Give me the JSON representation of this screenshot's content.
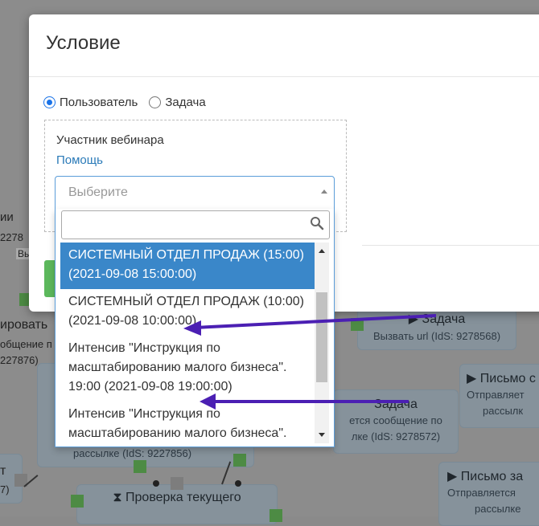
{
  "modal": {
    "title": "Условие",
    "radio_user": "Пользователь",
    "radio_task": "Задача",
    "field_label": "Участник вебинара",
    "help_link": "Помощь"
  },
  "select": {
    "placeholder": "Выберите",
    "search_value": "",
    "options": [
      "СИСТЕМНЫЙ ОТДЕЛ ПРОДАЖ (15:00) (2021-09-08 15:00:00)",
      "СИСТЕМНЫЙ ОТДЕЛ ПРОДАЖ (10:00) (2021-09-08 10:00:00)",
      "Интенсив \"Инструкция по масштабированию малого бизнеса\". 19:00 (2021-09-08 19:00:00)",
      "Интенсив \"Инструкция по масштабированию малого бизнеса\"."
    ],
    "selected_index": 0
  },
  "background": {
    "node_task_title": "▶ Задача",
    "node_task_sub": "Вызвать url (IdS: 9278568)",
    "node_task2_title": "Задача",
    "node_task2_sub1": "ется сообщение по",
    "node_task2_sub2": "лке (IdS: 9278572)",
    "node_letter1_title": "▶ Письмо с",
    "node_letter1_sub1": "Отправляет",
    "node_letter1_sub2": "рассылк",
    "node_letter2_title": "▶ Письмо за",
    "node_letter2_sub1": "Отправляется",
    "node_letter2_sub2": "рассылке",
    "node_check_title": "⧗ Проверка текущего",
    "left_text_1": "ии",
    "left_text_2": "2278",
    "left_text_3": "Вь",
    "left_text_4": "ировать",
    "left_text_5": "общение п",
    "left_text_6": "227876)",
    "left_text_7": "т",
    "left_text_8": "7)",
    "mid_text_1": "рассылке (IdS: 9227856)"
  },
  "colors": {
    "accent": "#3a87c9",
    "link": "#2a7ab8",
    "success": "#5cb85c",
    "annotation_arrow": "#4b1fb3"
  }
}
